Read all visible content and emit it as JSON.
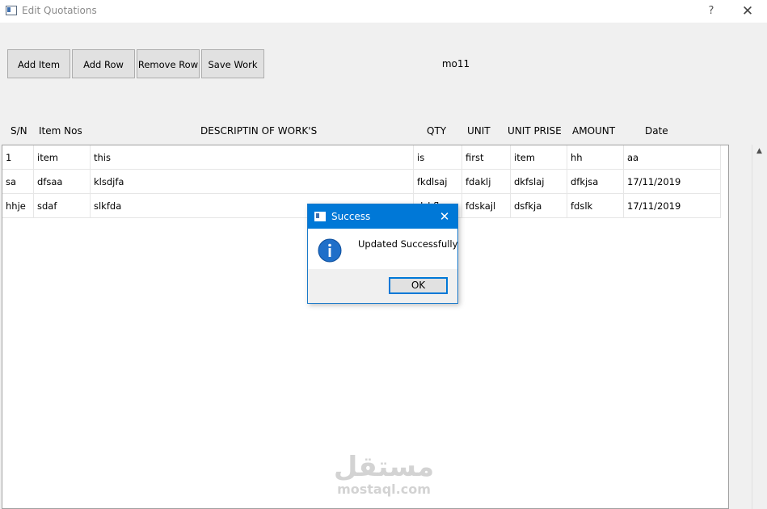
{
  "window": {
    "title": "Edit Quotations",
    "help_label": "?",
    "close_label": "✕"
  },
  "toolbar": {
    "add_item_label": "Add Item",
    "add_row_label": "Add Row",
    "remove_row_label": "Remove Row",
    "save_work_label": "Save Work"
  },
  "quotation": {
    "name": "mo11"
  },
  "table": {
    "headers": [
      "S/N",
      "Item Nos",
      "DESCRIPTIN OF WORK'S",
      "QTY",
      "UNIT",
      "UNIT PRISE",
      "AMOUNT",
      "Date"
    ],
    "rows": [
      [
        "1",
        "item",
        "this",
        "is",
        "first",
        "item",
        "hh",
        "aa"
      ],
      [
        "sa",
        "dfsaa",
        "klsdjfa",
        "fkdlsaj",
        "fdaklj",
        "dkfslaj",
        "dfkjsa",
        "17/11/2019"
      ],
      [
        "hhje",
        "sdaf",
        "slkfda",
        "dskfla",
        "fdskajl",
        "dsfkja",
        "fdslk",
        "17/11/2019"
      ]
    ]
  },
  "scrollbar": {
    "up_arrow": "▲"
  },
  "watermark": {
    "arabic": "مستقل",
    "latin": "mostaql.com"
  },
  "dialog": {
    "title": "Success",
    "close_label": "✕",
    "message": "Updated Successfully",
    "ok_label": "OK",
    "icon": "info-icon",
    "titlebar_color": "#0078d7"
  }
}
